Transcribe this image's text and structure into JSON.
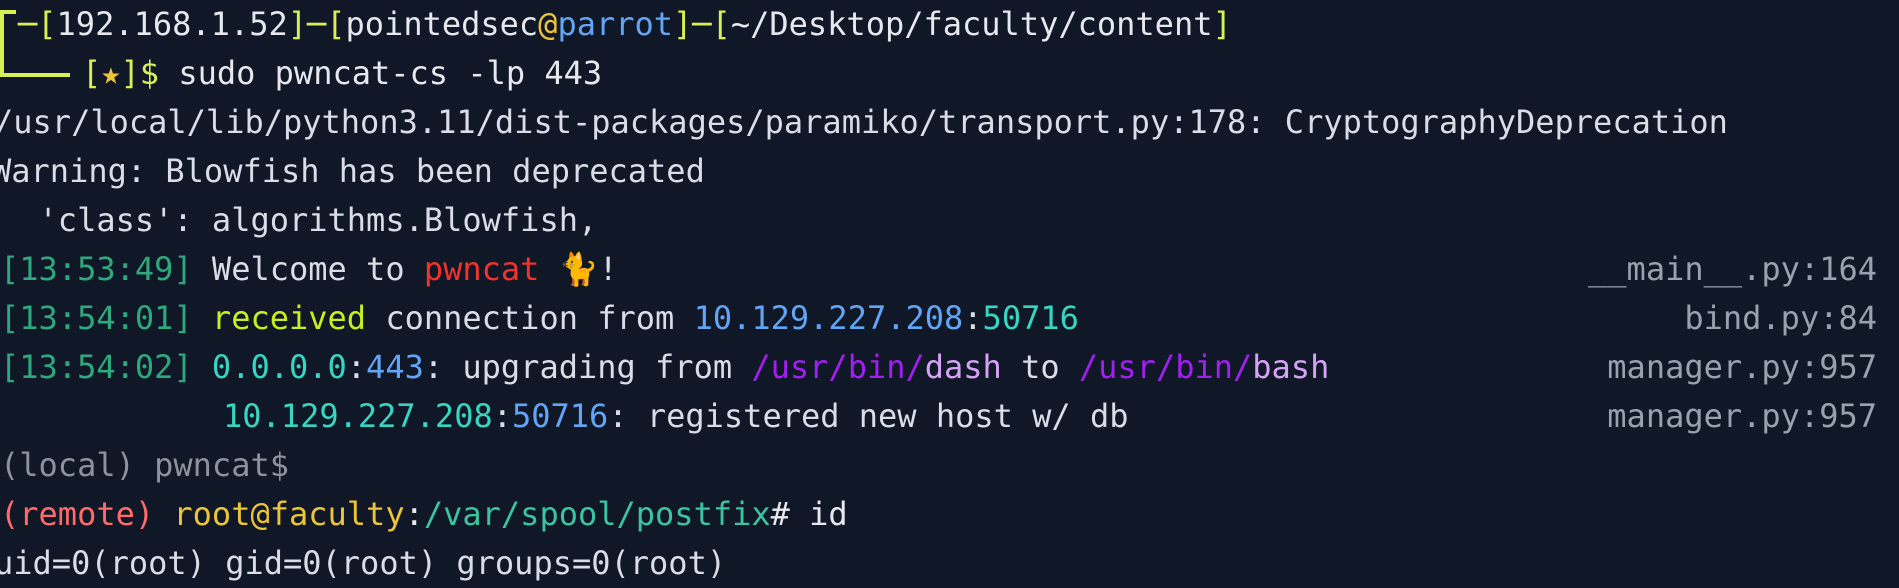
{
  "prompt": {
    "ip": "192.168.1.52",
    "user": "pointedsec",
    "at": "@",
    "host": "parrot",
    "cwd": "~/Desktop/faculty/content",
    "star": "★",
    "dollar": "$",
    "command": "sudo pwncat-cs -lp 443"
  },
  "warnings": [
    "/usr/local/lib/python3.11/dist-packages/paramiko/transport.py:178: CryptographyDeprecation",
    "Warning: Blowfish has been deprecated",
    "  'class': algorithms.Blowfish,"
  ],
  "log": [
    {
      "time": "[13:53:49]",
      "pre": "Welcome to ",
      "accent": "pwncat",
      "emoji": "🐈",
      "post": "!",
      "source": "__main__.py:164"
    },
    {
      "time": "[13:54:01]",
      "keyword": "received",
      "mid": " connection from ",
      "ip": "10.129.227.208",
      "colon": ":",
      "port": "50716",
      "source": "bind.py:84"
    },
    {
      "time": "[13:54:02]",
      "ip": "0.0.0.0",
      "colon": ":",
      "port": "443",
      "mid": ": upgrading from ",
      "from_dir": "/usr/bin/",
      "from_bin": "dash",
      "to": " to ",
      "to_dir": "/usr/bin/",
      "to_bin": "bash",
      "source": "manager.py:957"
    },
    {
      "ip": "10.129.227.208",
      "colon": ":",
      "port": "50716",
      "rest": ": registered new host w/ db",
      "source": "manager.py:957"
    }
  ],
  "local_prompt": "(local) pwncat$",
  "remote": {
    "tag": "(remote)",
    "user_host": "root@faculty",
    "colon": ":",
    "path": "/var/spool/postfix",
    "hash": "#",
    "command": " id"
  },
  "output": "uid=0(root) gid=0(root) groups=0(root)",
  "colors": {
    "background": "#101726",
    "prompt": "#d6f056",
    "blue": "#63a5f5",
    "timestamp": "#2ea87d",
    "red": "#f0332d",
    "purple": "#a020f0"
  }
}
